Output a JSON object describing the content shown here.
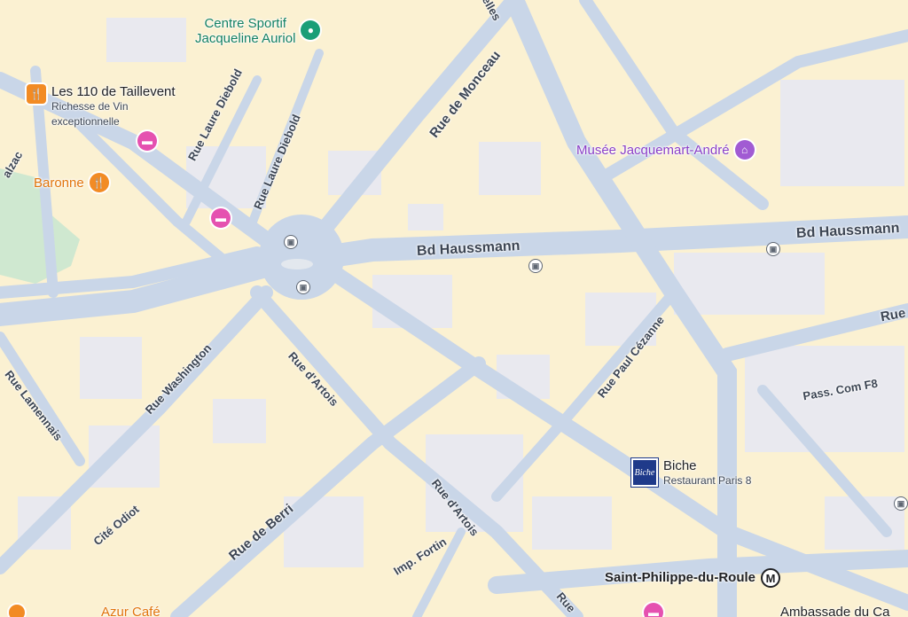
{
  "streets": {
    "rue_de_monceau": "Rue de Monceau",
    "rue_laure_diebold_1": "Rue Laure Diebold",
    "rue_laure_diebold_2": "Rue Laure Diebold",
    "bd_haussmann_1": "Bd Haussmann",
    "bd_haussmann_2": "Bd Haussmann",
    "rue_washington": "Rue Washington",
    "rue_dartois_1": "Rue d'Artois",
    "rue_dartois_2": "Rue d'Artois",
    "rue_paul_cezanne": "Rue Paul Cézanne",
    "rue_lamennais": "Rue Lamennais",
    "cite_odiot": "Cité Odiot",
    "rue_de_berri": "Rue de Berri",
    "imp_fortin": "Imp. Fortin",
    "pass_com_f8": "Pass. Com F8",
    "rue_right": "Rue",
    "balzac_partial": "alzac",
    "elles_partial": "elles",
    "rue_bottom_partial": "Rue"
  },
  "pois": {
    "centre_sportif": {
      "name": "Centre Sportif Jacqueline Auriol",
      "line1": "Centre Sportif",
      "line2": "Jacqueline Auriol",
      "icon": "sports-pin-icon",
      "color": "#1a9e77"
    },
    "taillevent": {
      "name": "Les 110 de Taillevent",
      "sub1": "Richesse de Vin",
      "sub2": "exceptionnelle",
      "icon": "restaurant-icon",
      "color": "#f28b24"
    },
    "baronne": {
      "name": "Baronne",
      "icon": "restaurant-icon",
      "color": "#f28b24"
    },
    "jacquemart": {
      "name": "Musée Jacquemart-André",
      "icon": "museum-icon",
      "color": "#a15bd3"
    },
    "biche": {
      "name": "Biche",
      "sub": "Restaurant Paris 8",
      "icon": "restaurant-logo-icon",
      "logo_text": "Biche"
    },
    "saint_philippe": {
      "name": "Saint-Philippe-du-Roule",
      "icon": "metro-icon",
      "metro_letter": "M"
    },
    "azur_cafe": {
      "name": "Azur Café",
      "icon": "restaurant-icon"
    },
    "ambassade": {
      "name": "Ambassade du Ca"
    }
  },
  "icons": {
    "hotel": "hotel-icon",
    "bus": "bus-stop-icon"
  },
  "colors": {
    "road": "#c9d6e8",
    "block": "#fbf1d2",
    "block_alt": "#eeeef3",
    "park": "#cfe8d0"
  }
}
